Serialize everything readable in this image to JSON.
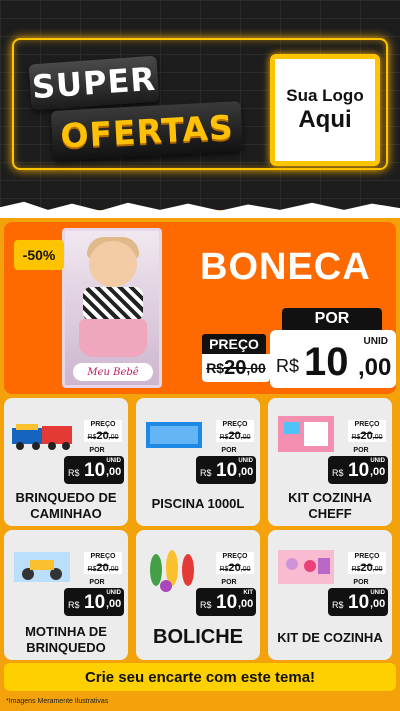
{
  "header": {
    "title_line1": "SUPER",
    "title_line2": "OFERTAS",
    "logo_line1": "Sua Logo",
    "logo_line2": "Aqui"
  },
  "featured": {
    "discount": "-50%",
    "name": "BONECA",
    "box_label": "Meu Bebê",
    "por_label": "POR",
    "preco_label": "PREÇO",
    "old_price_prefix": "R$",
    "old_price_int": "20",
    "old_price_dec": ",00",
    "new_price_prefix": "R$",
    "new_price_int": "10",
    "new_price_dec": ",00",
    "unit": "UNID"
  },
  "products": [
    {
      "name": "BRINQUEDO DE CAMINHAO",
      "preco_label": "PREÇO",
      "old_prefix": "R$",
      "old_int": "20",
      "old_dec": ",00",
      "por_label": "POR",
      "prefix": "R$",
      "int": "10",
      "dec": ",00",
      "unit": "UNID",
      "icon": "truck-toy-icon"
    },
    {
      "name": "PISCINA 1000L",
      "preco_label": "PREÇO",
      "old_prefix": "R$",
      "old_int": "20",
      "old_dec": ",00",
      "por_label": "POR",
      "prefix": "R$",
      "int": "10",
      "dec": ",00",
      "unit": "UNID",
      "icon": "pool-icon"
    },
    {
      "name": "KIT COZINHA CHEFF",
      "preco_label": "PREÇO",
      "old_prefix": "R$",
      "old_int": "20",
      "old_dec": ",00",
      "por_label": "POR",
      "prefix": "R$",
      "int": "10",
      "dec": ",00",
      "unit": "UNID",
      "icon": "kitchen-toy-icon"
    },
    {
      "name": "MOTINHA DE BRINQUEDO",
      "preco_label": "PREÇO",
      "old_prefix": "R$",
      "old_int": "20",
      "old_dec": ",00",
      "por_label": "POR",
      "prefix": "R$",
      "int": "10",
      "dec": ",00",
      "unit": "UNID",
      "icon": "toy-motorbike-icon"
    },
    {
      "name": "BOLICHE",
      "preco_label": "PREÇO",
      "old_prefix": "R$",
      "old_int": "20",
      "old_dec": ",00",
      "por_label": "POR",
      "prefix": "R$",
      "int": "10",
      "dec": ",00",
      "unit": "KIT",
      "icon": "bowling-pins-icon"
    },
    {
      "name": "KIT DE COZINHA",
      "preco_label": "PREÇO",
      "old_prefix": "R$",
      "old_int": "20",
      "old_dec": ",00",
      "por_label": "POR",
      "prefix": "R$",
      "int": "10",
      "dec": ",00",
      "unit": "UNID",
      "icon": "kitchen-set-icon"
    }
  ],
  "footer": {
    "cta": "Crie seu encarte com este tema!",
    "disclaimer": "*Imagens Meramente Ilustrativas"
  },
  "colors": {
    "brand_orange": "#ff6a00",
    "accent_yellow": "#ffc400",
    "background": "#f4a20c"
  }
}
